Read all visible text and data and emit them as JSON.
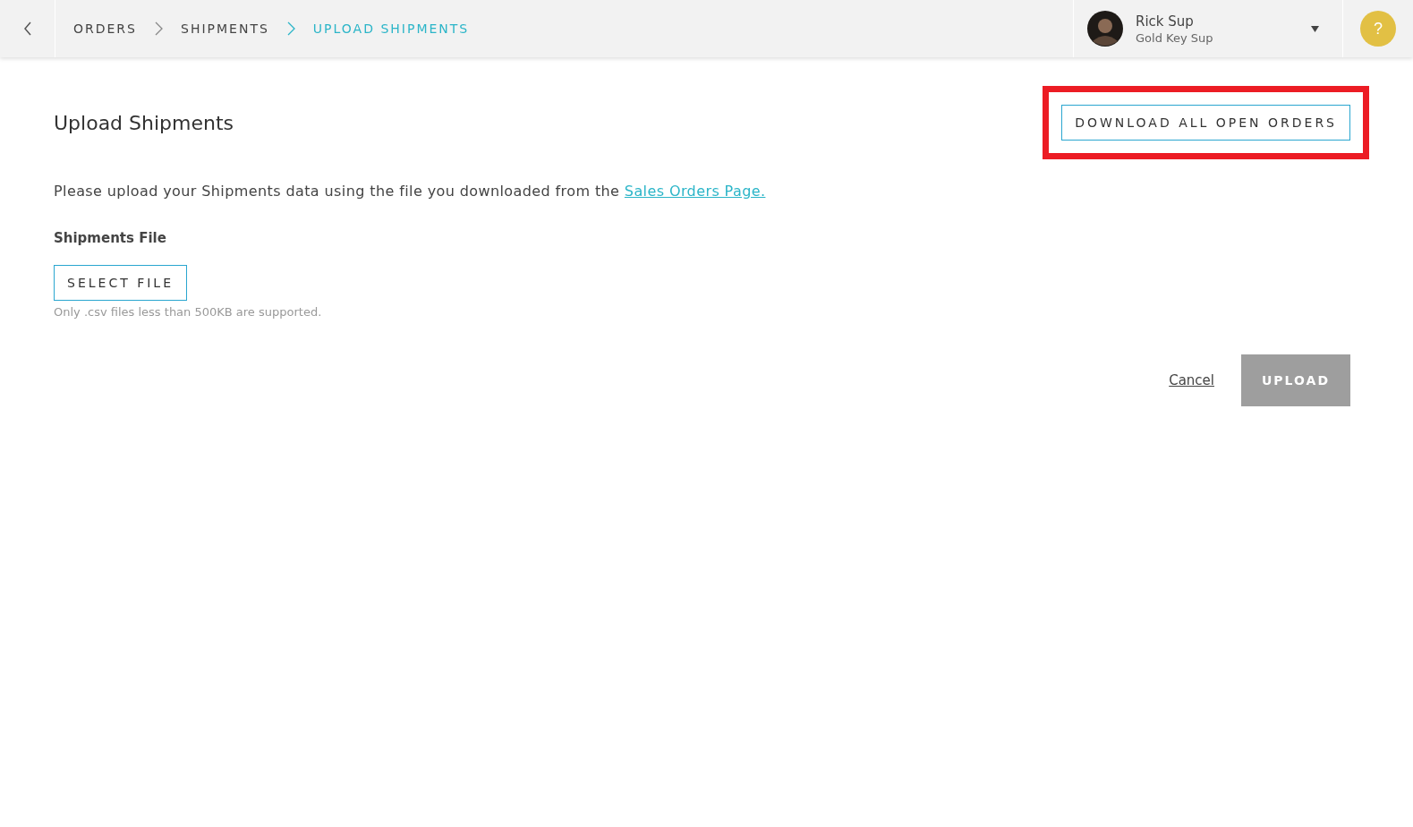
{
  "header": {
    "breadcrumbs": [
      {
        "label": "ORDERS",
        "selected": false
      },
      {
        "label": "SHIPMENTS",
        "selected": false
      },
      {
        "label": "UPLOAD SHIPMENTS",
        "selected": true
      }
    ],
    "user": {
      "name": "Rick Sup",
      "role": "Gold Key Sup"
    },
    "help": "?"
  },
  "page": {
    "title": "Upload Shipments",
    "download_button": {
      "label": "DOWNLOAD ALL OPEN ORDERS",
      "highlighted": true
    },
    "intro": {
      "text": "Please upload your Shipments data using the file you downloaded from the",
      "link": "Sales Orders Page."
    },
    "file_label": "Shipments File",
    "select_button": "SELECT FILE",
    "hint": "Only .csv files less than 500KB are supported.",
    "cancel": "Cancel",
    "upload": {
      "label": "UPLOAD",
      "disabled": true
    }
  }
}
